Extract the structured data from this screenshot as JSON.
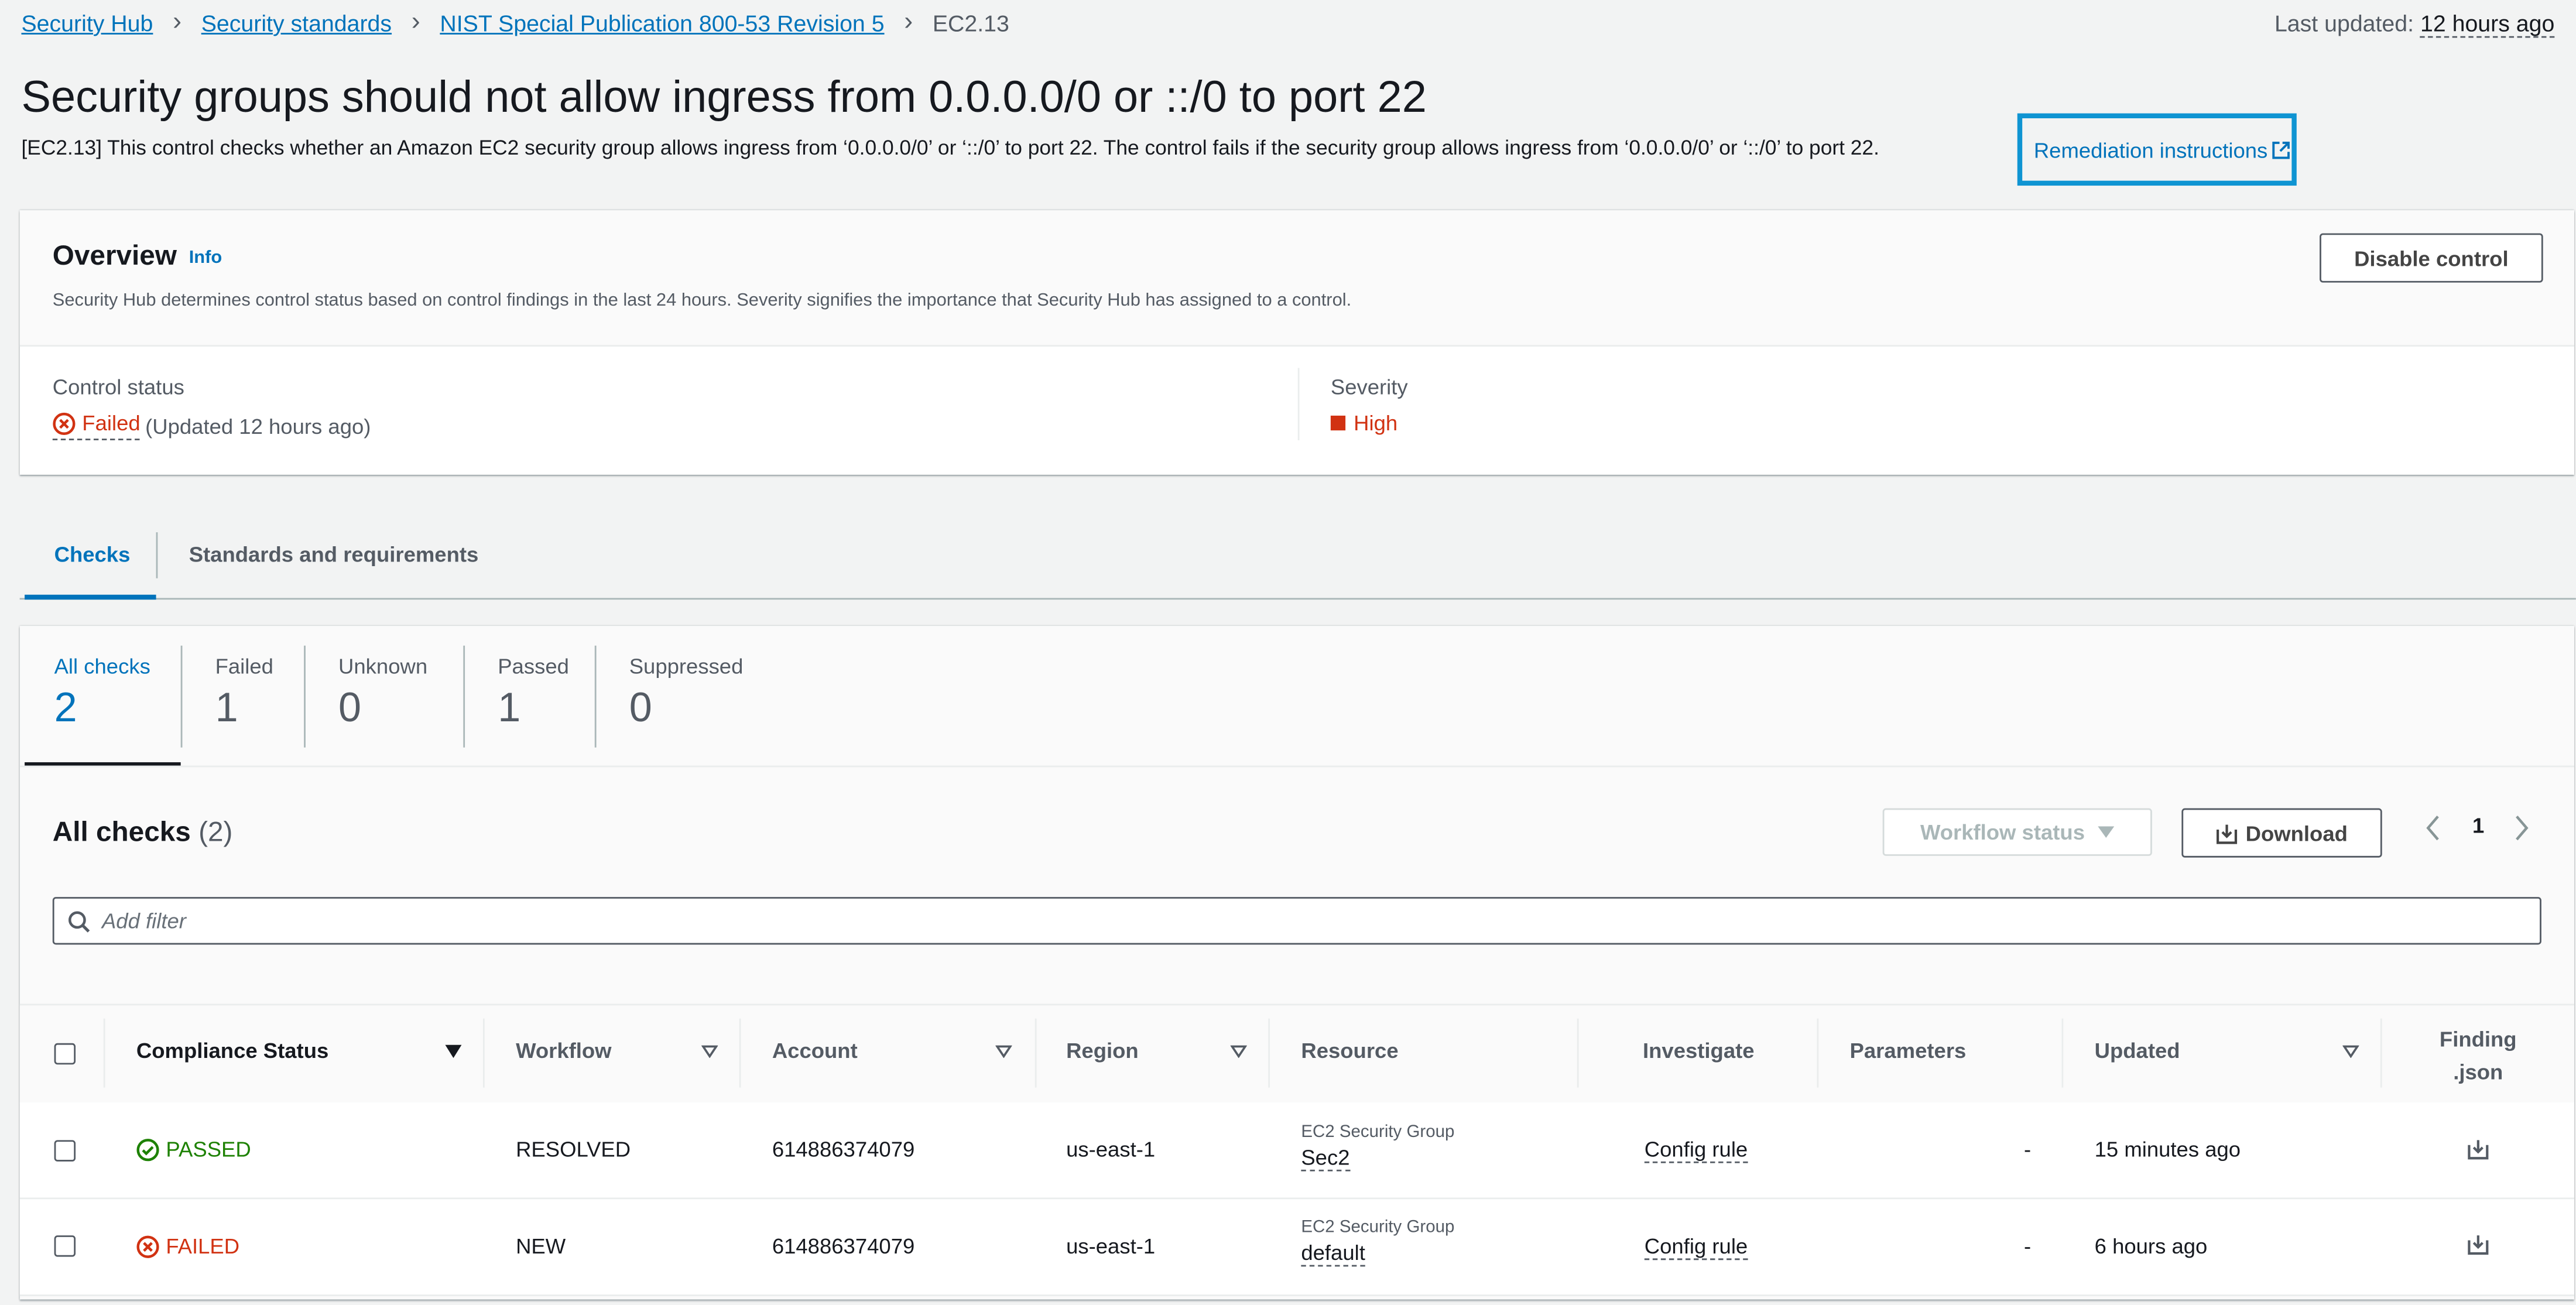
{
  "breadcrumb": {
    "items": [
      "Security Hub",
      "Security standards",
      "NIST Special Publication 800-53 Revision 5"
    ],
    "current": "EC2.13"
  },
  "last_updated": {
    "label": "Last updated:",
    "value": "12 hours ago"
  },
  "page": {
    "title": "Security groups should not allow ingress from 0.0.0.0/0 or ::/0 to port 22",
    "description": "[EC2.13] This control checks whether an Amazon EC2 security group allows ingress from ‘0.0.0.0/0’ or ‘::/0’ to port 22. The control fails if the security group allows ingress from ‘0.0.0.0/0’ or ‘::/0’ to port 22.",
    "remediation_link": "Remediation instructions"
  },
  "overview": {
    "title": "Overview",
    "info": "Info",
    "subtitle": "Security Hub determines control status based on control findings in the last 24 hours. Severity signifies the importance that Security Hub has assigned to a control.",
    "disable_button": "Disable control",
    "control_status_label": "Control status",
    "control_status_value": "Failed",
    "control_status_note": "(Updated 12 hours ago)",
    "severity_label": "Severity",
    "severity_value": "High"
  },
  "tabs": [
    "Checks",
    "Standards and requirements"
  ],
  "stats": [
    {
      "label": "All checks",
      "value": "2"
    },
    {
      "label": "Failed",
      "value": "1"
    },
    {
      "label": "Unknown",
      "value": "0"
    },
    {
      "label": "Passed",
      "value": "1"
    },
    {
      "label": "Suppressed",
      "value": "0"
    }
  ],
  "table": {
    "title": "All checks",
    "count": "(2)",
    "workflow_button": "Workflow status",
    "download_button": "Download",
    "page_number": "1",
    "filter_placeholder": "Add filter",
    "columns": [
      "Compliance Status",
      "Workflow",
      "Account",
      "Region",
      "Resource",
      "Investigate",
      "Parameters",
      "Updated",
      "Finding",
      ".json"
    ],
    "rows": [
      {
        "status": "PASSED",
        "workflow": "RESOLVED",
        "account": "614886374079",
        "region": "us-east-1",
        "resource_type": "EC2 Security Group",
        "resource_name": "Sec2",
        "investigate": "Config rule",
        "parameters": "-",
        "updated": "15 minutes ago"
      },
      {
        "status": "FAILED",
        "workflow": "NEW",
        "account": "614886374079",
        "region": "us-east-1",
        "resource_type": "EC2 Security Group",
        "resource_name": "default",
        "investigate": "Config rule",
        "parameters": "-",
        "updated": "6 hours ago"
      }
    ]
  },
  "colors": {
    "link": "#0073bb",
    "failed": "#d13212",
    "passed": "#1d8102",
    "highlight_box": "#0f94d2"
  }
}
